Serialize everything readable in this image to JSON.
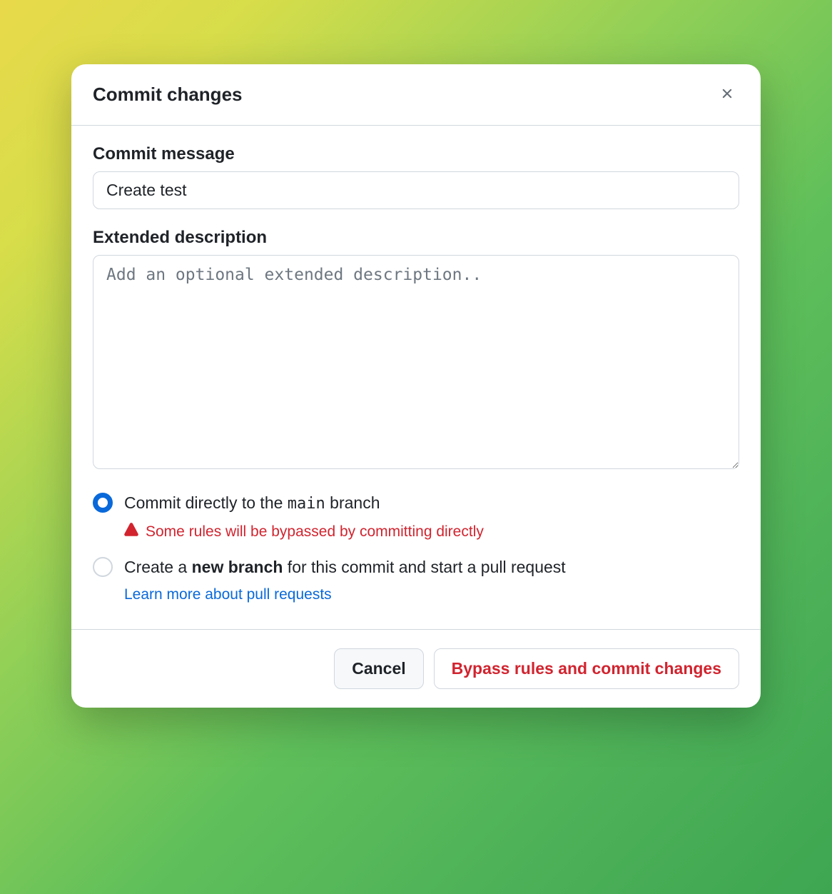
{
  "dialog": {
    "title": "Commit changes",
    "commit_message_label": "Commit message",
    "commit_message_value": "Create test",
    "extended_description_label": "Extended description",
    "extended_description_placeholder": "Add an optional extended description..",
    "radio_direct_prefix": "Commit directly to the ",
    "radio_direct_branch": "main",
    "radio_direct_suffix": " branch",
    "warning_text": "Some rules will be bypassed by committing directly",
    "radio_new_prefix": "Create a ",
    "radio_new_bold": "new branch",
    "radio_new_suffix": " for this commit and start a pull request",
    "learn_more_text": "Learn more about pull requests",
    "cancel_label": "Cancel",
    "commit_label": "Bypass rules and commit changes"
  }
}
